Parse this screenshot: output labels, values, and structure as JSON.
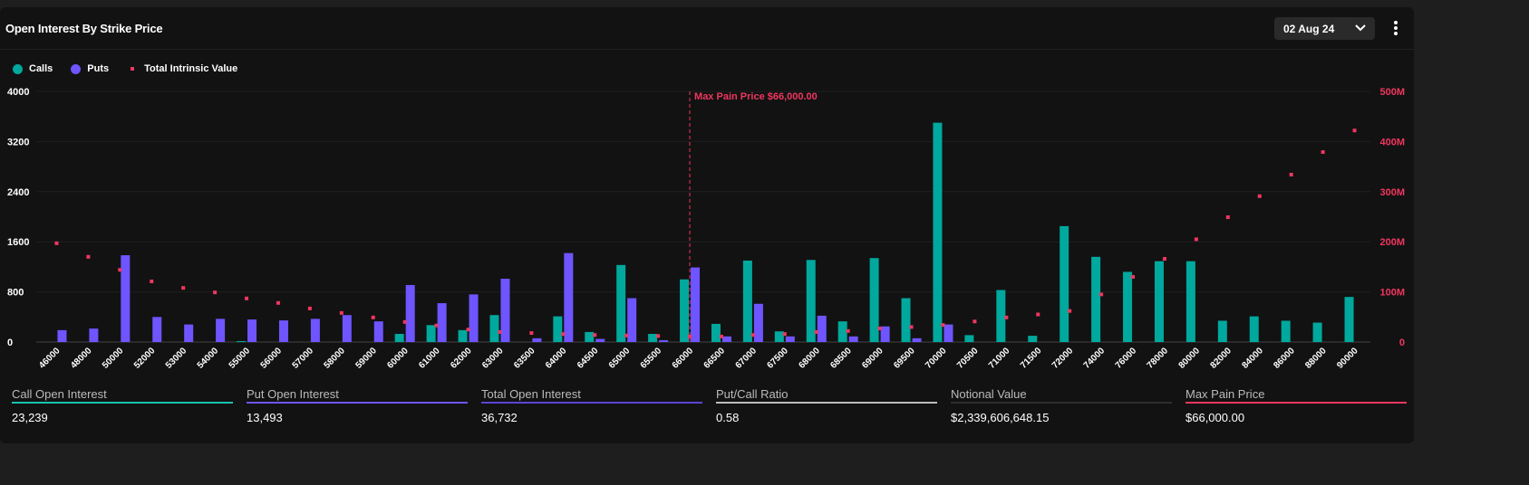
{
  "header": {
    "title": "Open Interest By Strike Price",
    "date": "02 Aug 24"
  },
  "legend": {
    "calls": "Calls",
    "puts": "Puts",
    "intrinsic": "Total Intrinsic Value"
  },
  "colors": {
    "calls": "#00a89d",
    "puts": "#6e55ff",
    "intrinsic": "#f0365f",
    "grid": "#1f1f1f"
  },
  "chart_data": {
    "type": "bar",
    "title": "Open Interest By Strike Price",
    "categories": [
      "46000",
      "48000",
      "50000",
      "52000",
      "53000",
      "54000",
      "55000",
      "56000",
      "57000",
      "58000",
      "59000",
      "60000",
      "61000",
      "62000",
      "63000",
      "63500",
      "64000",
      "64500",
      "65000",
      "65500",
      "66000",
      "66500",
      "67000",
      "67500",
      "68000",
      "68500",
      "69000",
      "69500",
      "70000",
      "70500",
      "71000",
      "71500",
      "72000",
      "74000",
      "76000",
      "78000",
      "80000",
      "82000",
      "84000",
      "86000",
      "88000",
      "90000"
    ],
    "series": [
      {
        "name": "Calls",
        "axis": "left",
        "values": [
          0,
          0,
          0,
          0,
          0,
          0,
          15,
          0,
          0,
          0,
          0,
          130,
          270,
          190,
          430,
          0,
          410,
          160,
          1230,
          130,
          1000,
          290,
          1300,
          170,
          1310,
          330,
          1340,
          700,
          3500,
          110,
          830,
          100,
          1850,
          1360,
          1120,
          1290,
          1290,
          340,
          410,
          340,
          310,
          720
        ]
      },
      {
        "name": "Puts",
        "axis": "left",
        "values": [
          190,
          215,
          1385,
          400,
          280,
          370,
          360,
          345,
          370,
          430,
          330,
          910,
          620,
          760,
          1010,
          60,
          1420,
          50,
          700,
          30,
          1190,
          90,
          610,
          90,
          420,
          90,
          250,
          60,
          280,
          0,
          0,
          0,
          0,
          0,
          0,
          0,
          0,
          0,
          0,
          0,
          0,
          0
        ]
      },
      {
        "name": "Total Intrinsic Value",
        "axis": "right",
        "unit": "M",
        "values": [
          197,
          170,
          144,
          121,
          108,
          99,
          87,
          78,
          67,
          58,
          49,
          40,
          33,
          25,
          20,
          18,
          16,
          14,
          13,
          12,
          11,
          11,
          14,
          16,
          20,
          22,
          27,
          30,
          34,
          41,
          49,
          55,
          62,
          95,
          130,
          166,
          205,
          249,
          291,
          334,
          379,
          422
        ]
      }
    ],
    "ylim": [
      0,
      4000
    ],
    "yticks": [
      "0",
      "800",
      "1600",
      "2400",
      "3200",
      "4000"
    ],
    "y2lim": [
      0,
      500
    ],
    "y2ticks": [
      "0",
      "100M",
      "200M",
      "300M",
      "400M",
      "500M"
    ],
    "annotation": {
      "label": "Max Pain Price $66,000.00",
      "category": "66000"
    },
    "grid": true,
    "legend": "top-left"
  },
  "stats": [
    {
      "label": "Call Open Interest",
      "value": "23,239",
      "color": "#19c3b0"
    },
    {
      "label": "Put Open Interest",
      "value": "13,493",
      "color": "#6e55ff"
    },
    {
      "label": "Total Open Interest",
      "value": "36,732",
      "color": "#5a44d6"
    },
    {
      "label": "Put/Call Ratio",
      "value": "0.58",
      "color": "#bdbdbd"
    },
    {
      "label": "Notional Value",
      "value": "$2,339,606,648.15",
      "color": "#2e2e2e"
    },
    {
      "label": "Max Pain Price",
      "value": "$66,000.00",
      "color": "#f0365f"
    }
  ]
}
